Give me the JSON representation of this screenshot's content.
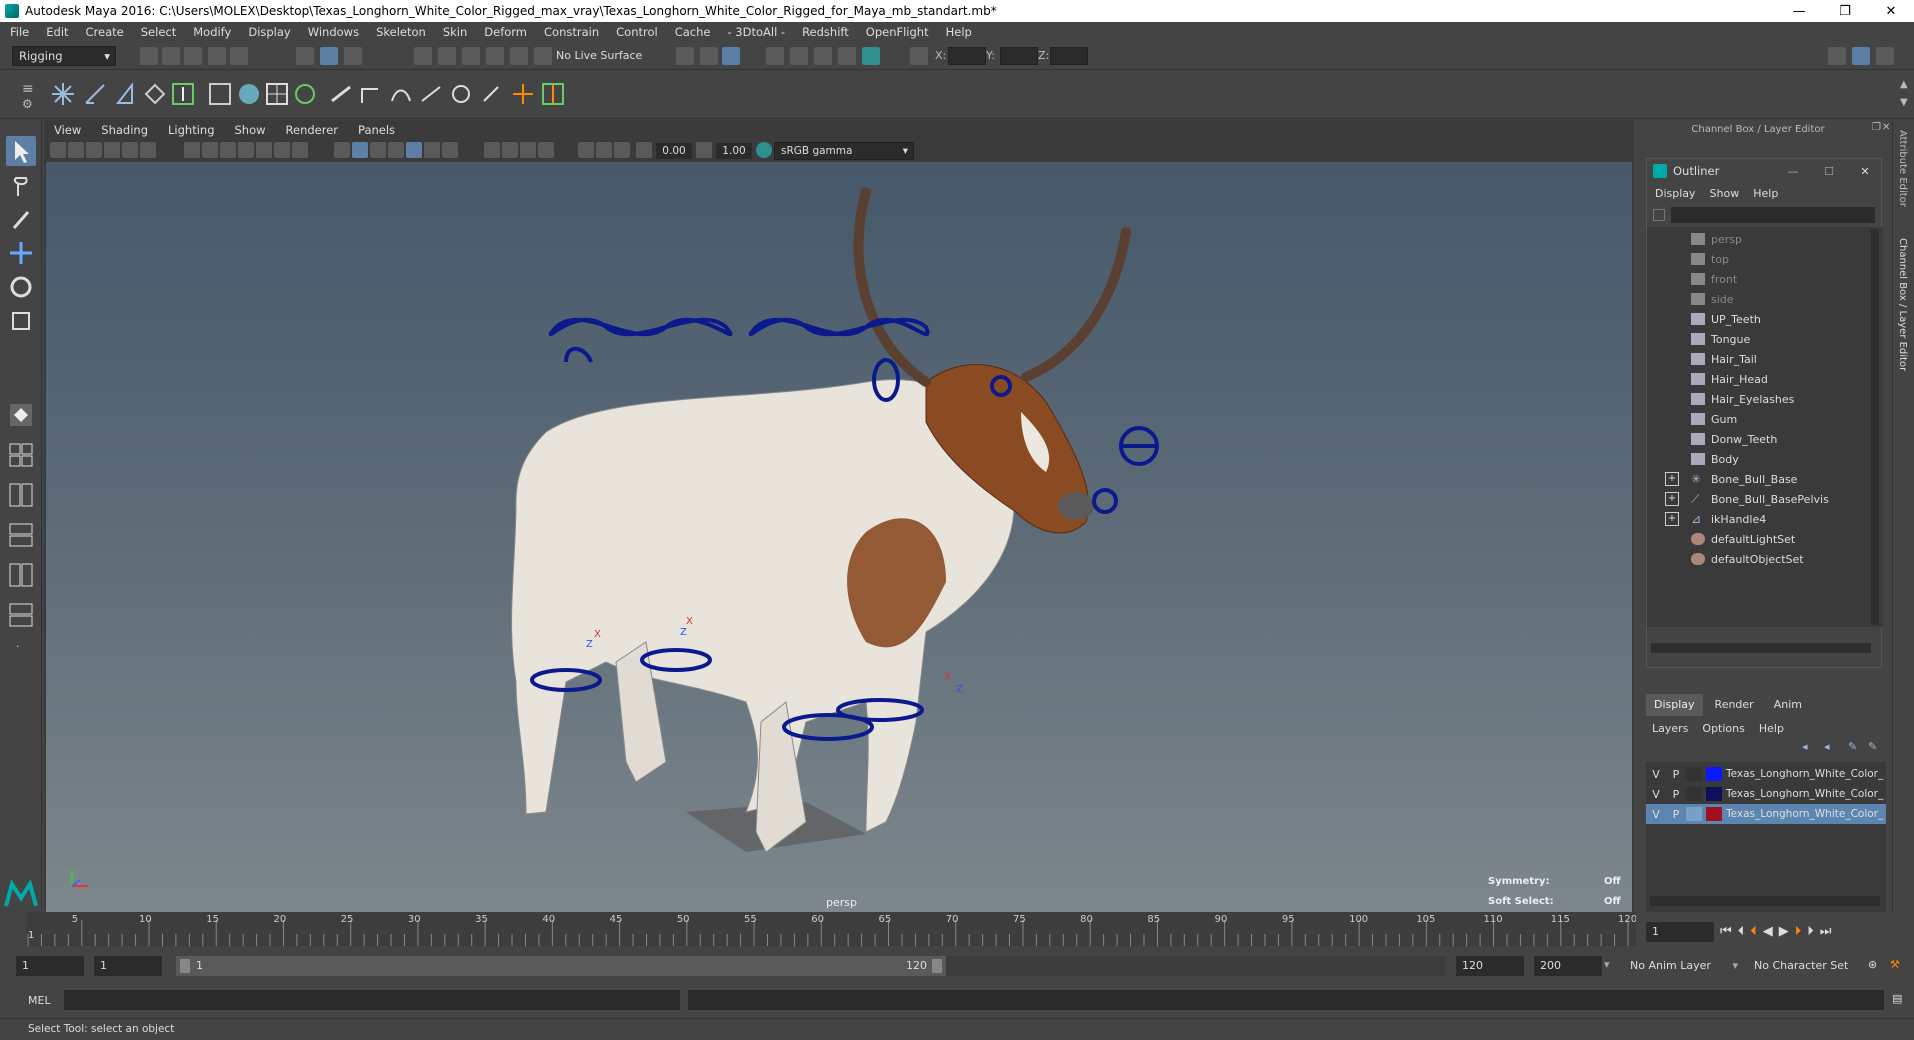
{
  "window": {
    "title": "Autodesk Maya 2016: C:\\Users\\MOLEX\\Desktop\\Texas_Longhorn_White_Color_Rigged_max_vray\\Texas_Longhorn_White_Color_Rigged_for_Maya_mb_standart.mb*",
    "minimize": "—",
    "restore": "❐",
    "close": "✕"
  },
  "menubar": [
    "File",
    "Edit",
    "Create",
    "Select",
    "Modify",
    "Display",
    "Windows",
    "Skeleton",
    "Skin",
    "Deform",
    "Constrain",
    "Control",
    "Cache",
    "- 3DtoAll -",
    "Redshift",
    "OpenFlight",
    "Help"
  ],
  "statusline": {
    "menuset": "Rigging",
    "live_surface": "No Live Surface",
    "x_label": "X:",
    "y_label": "Y:",
    "z_label": "Z:"
  },
  "viewport": {
    "menus": [
      "View",
      "Shading",
      "Lighting",
      "Show",
      "Renderer",
      "Panels"
    ],
    "near_value": "0.00",
    "far_value": "1.00",
    "color_space": "sRGB gamma",
    "camera_label": "persp",
    "symmetry_label": "Symmetry:",
    "symmetry_value": "Off",
    "soft_select_label": "Soft Select:",
    "soft_select_value": "Off",
    "axis_labels": [
      "X",
      "Z"
    ]
  },
  "channel_box_title": "Channel Box / Layer Editor",
  "side_tabs": [
    "Attribute Editor",
    "Channel Box / Layer Editor"
  ],
  "outliner": {
    "title": "Outliner",
    "menus": [
      "Display",
      "Show",
      "Help"
    ],
    "items": [
      {
        "label": "persp",
        "type": "camera",
        "dim": true,
        "expand": false
      },
      {
        "label": "top",
        "type": "camera",
        "dim": true,
        "expand": false
      },
      {
        "label": "front",
        "type": "camera",
        "dim": true,
        "expand": false
      },
      {
        "label": "side",
        "type": "camera",
        "dim": true,
        "expand": false
      },
      {
        "label": "UP_Teeth",
        "type": "mesh",
        "dim": false,
        "expand": false
      },
      {
        "label": "Tongue",
        "type": "mesh",
        "dim": false,
        "expand": false
      },
      {
        "label": "Hair_Tail",
        "type": "mesh",
        "dim": false,
        "expand": false
      },
      {
        "label": "Hair_Head",
        "type": "mesh",
        "dim": false,
        "expand": false
      },
      {
        "label": "Hair_Eyelashes",
        "type": "mesh",
        "dim": false,
        "expand": false
      },
      {
        "label": "Gum",
        "type": "mesh",
        "dim": false,
        "expand": false
      },
      {
        "label": "Donw_Teeth",
        "type": "mesh",
        "dim": false,
        "expand": false
      },
      {
        "label": "Body",
        "type": "mesh",
        "dim": false,
        "expand": false
      },
      {
        "label": "Bone_Bull_Base",
        "type": "joint",
        "dim": false,
        "expand": true
      },
      {
        "label": "Bone_Bull_BasePelvis",
        "type": "joint",
        "dim": false,
        "expand": true
      },
      {
        "label": "ikHandle4",
        "type": "ik",
        "dim": false,
        "expand": true
      },
      {
        "label": "defaultLightSet",
        "type": "set",
        "dim": false,
        "expand": false
      },
      {
        "label": "defaultObjectSet",
        "type": "set",
        "dim": false,
        "expand": false
      }
    ]
  },
  "layer_editor": {
    "tabs": [
      "Display",
      "Render",
      "Anim"
    ],
    "menus": [
      "Layers",
      "Options",
      "Help"
    ],
    "layers": [
      {
        "v": "V",
        "p": "P",
        "color": "#0a1aff",
        "name": "Texas_Longhorn_White_Color_",
        "selected": false
      },
      {
        "v": "V",
        "p": "P",
        "color": "#10105a",
        "name": "Texas_Longhorn_White_Color_",
        "selected": false
      },
      {
        "v": "V",
        "p": "P",
        "color": "#a01020",
        "name": "Texas_Longhorn_White_Color_",
        "selected": true
      }
    ]
  },
  "timeline": {
    "ticks": [
      "5",
      "10",
      "15",
      "20",
      "25",
      "30",
      "35",
      "40",
      "45",
      "50",
      "55",
      "60",
      "65",
      "70",
      "75",
      "80",
      "85",
      "90",
      "95",
      "100",
      "105",
      "110",
      "115",
      "120"
    ],
    "start_tick": "1",
    "current_frame": "1"
  },
  "range": {
    "start": "1",
    "playback_start": "1",
    "slider_start": "1",
    "slider_end": "120",
    "playback_end": "120",
    "end": "200",
    "anim_layer": "No Anim Layer",
    "character_set": "No Character Set"
  },
  "cmdline": {
    "label": "MEL"
  },
  "helpline": {
    "text": "Select Tool: select an object"
  }
}
